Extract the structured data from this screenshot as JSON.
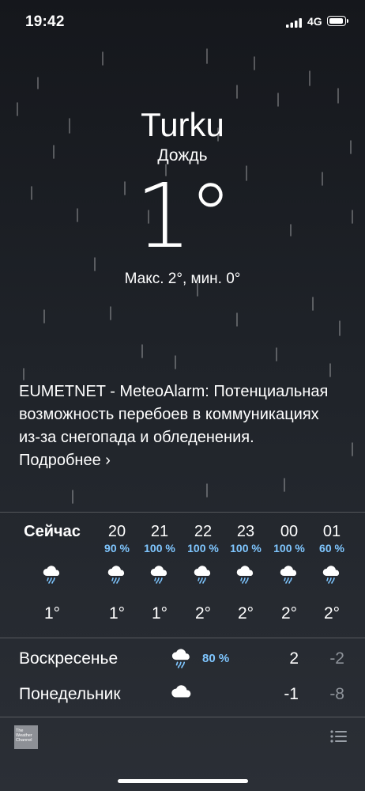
{
  "status": {
    "time": "19:42",
    "network": "4G"
  },
  "location": {
    "city": "Turku",
    "condition": "Дождь",
    "temperature": "1°",
    "minmax": "Макс. 2°, мин. 0°"
  },
  "alert": {
    "text": "EUMETNET - MeteoAlarm: Потенциальная возможность перебоев в коммуникациях из-за снегопада и обледенения.",
    "more": "Подробнее ›"
  },
  "hourly": [
    {
      "label": "Сейчас",
      "prob": "",
      "temp": "1°",
      "icon": "rain-cloud-icon"
    },
    {
      "label": "20",
      "prob": "90 %",
      "temp": "1°",
      "icon": "rain-cloud-icon"
    },
    {
      "label": "21",
      "prob": "100 %",
      "temp": "1°",
      "icon": "rain-cloud-icon"
    },
    {
      "label": "22",
      "prob": "100 %",
      "temp": "2°",
      "icon": "rain-cloud-icon"
    },
    {
      "label": "23",
      "prob": "100 %",
      "temp": "2°",
      "icon": "rain-cloud-icon"
    },
    {
      "label": "00",
      "prob": "100 %",
      "temp": "2°",
      "icon": "rain-cloud-icon"
    },
    {
      "label": "01",
      "prob": "60 %",
      "temp": "2°",
      "icon": "rain-cloud-icon"
    }
  ],
  "daily": [
    {
      "day": "Воскресенье",
      "icon": "rain-cloud-icon",
      "prob": "80 %",
      "high": "2",
      "low": "-2"
    },
    {
      "day": "Понедельник",
      "icon": "cloud-icon",
      "prob": "",
      "high": "-1",
      "low": "-8"
    }
  ],
  "footer": {
    "logo_text": "The Weather Channel",
    "list_icon": "list-icon"
  },
  "colors": {
    "probability": "#7fc6ff",
    "low_temp": "#8e939a"
  }
}
